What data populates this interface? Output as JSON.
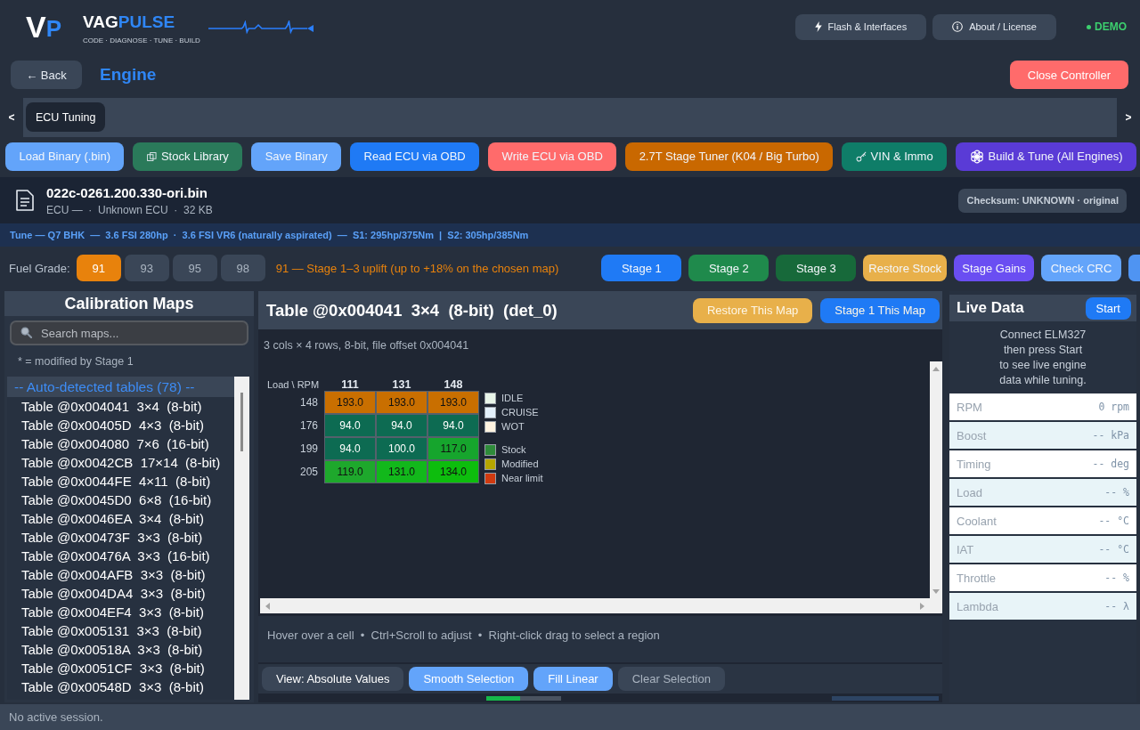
{
  "header": {
    "logo": [
      {
        "text": "V",
        "accent": false
      },
      {
        "text": "P",
        "accent": true
      }
    ],
    "brand": [
      {
        "text": "VAG",
        "accent": false
      },
      {
        "text": "PULSE",
        "accent": true
      }
    ],
    "tagline": "CODE · DIAGNOSE · TUNE · BUILD",
    "buttons": [
      {
        "label": "Flash & Interfaces"
      },
      {
        "label": "About / License"
      }
    ],
    "mode": {
      "label": "DEMO",
      "color": "#3ccf6e"
    }
  },
  "nav": {
    "back": "← Back",
    "title": "Engine",
    "close": "Close Controller"
  },
  "tabs": {
    "prev": "<",
    "next": ">",
    "items": [
      {
        "label": "ECU Tuning",
        "selected": true
      }
    ]
  },
  "toolbar": [
    {
      "label": "Load Binary (.bin)",
      "color": "#63a4fa"
    },
    {
      "label": "Stock Library",
      "color": "#2a7a5a"
    },
    {
      "label": "Save Binary",
      "color": "#63a4fa"
    },
    {
      "label": "Read ECU via OBD",
      "color": "#1f7af5"
    },
    {
      "label": "Write ECU via OBD",
      "color": "#ff6b6b"
    },
    {
      "label": "2.7T Stage Tuner (K04 / Big Turbo)",
      "color": "#c96800"
    },
    {
      "label": "VIN & Immo",
      "color": "#0f7d68"
    },
    {
      "label": "Build & Tune (All Engines)",
      "color": "#5a3bd6"
    }
  ],
  "file": {
    "name": "022c-0261.200.330-ori.bin",
    "meta": "ECU —  ·  Unknown ECU  ·  32 KB",
    "checksum": "Checksum: UNKNOWN · original"
  },
  "tune_line": "Tune — Q7 BHK  —  3.6 FSI 280hp  ·  3.6 FSI VR6 (naturally aspirated)  —  S1: 295hp/375Nm  |  S2: 305hp/385Nm",
  "fuel": {
    "label": "Fuel Grade:",
    "options": [
      {
        "label": "91",
        "selected": true
      },
      {
        "label": "93",
        "selected": false
      },
      {
        "label": "95",
        "selected": false
      },
      {
        "label": "98",
        "selected": false
      }
    ],
    "note": "91 — Stage 1–3 uplift (up to +18% on the chosen map)"
  },
  "stage_actions": [
    {
      "label": "Stage 1",
      "color": "#1f7af5"
    },
    {
      "label": "Stage 2",
      "color": "#1f8a4c"
    },
    {
      "label": "Stage 3",
      "color": "#17693a"
    },
    {
      "label": "Restore Stock",
      "color": "#e8b04a"
    },
    {
      "label": "Stage Gains",
      "color": "#6a4ef2"
    },
    {
      "label": "Check CRC",
      "color": "#63a4fa"
    }
  ],
  "stage_actions_cut": {
    "color": "#4f94f2"
  },
  "sidebar": {
    "title": "Calibration Maps",
    "search": {
      "placeholder": "Search maps..."
    },
    "note": "* = modified by Stage 1",
    "group": "-- Auto-detected tables (78) --",
    "items": [
      {
        "label": "Table @0x004041  3×4  (8-bit)",
        "selected": false
      },
      {
        "label": "Table @0x00405D  4×3  (8-bit)",
        "selected": false
      },
      {
        "label": "Table @0x004080  7×6  (16-bit)",
        "selected": false
      },
      {
        "label": "Table @0x0042CB  17×14  (8-bit)",
        "selected": false
      },
      {
        "label": "Table @0x0044FE  4×11  (8-bit)",
        "selected": false
      },
      {
        "label": "Table @0x0045D0  6×8  (16-bit)",
        "selected": false
      },
      {
        "label": "Table @0x0046EA  3×4  (8-bit)",
        "selected": false
      },
      {
        "label": "Table @0x00473F  3×3  (8-bit)",
        "selected": false
      },
      {
        "label": "Table @0x00476A  3×3  (16-bit)",
        "selected": false
      },
      {
        "label": "Table @0x004AFB  3×3  (8-bit)",
        "selected": false
      },
      {
        "label": "Table @0x004DA4  3×3  (8-bit)",
        "selected": false
      },
      {
        "label": "Table @0x004EF4  3×3  (8-bit)",
        "selected": false
      },
      {
        "label": "Table @0x005131  3×3  (8-bit)",
        "selected": false
      },
      {
        "label": "Table @0x00518A  3×3  (8-bit)",
        "selected": false
      },
      {
        "label": "Table @0x0051CF  3×3  (8-bit)",
        "selected": false
      },
      {
        "label": "Table @0x00548D  3×3  (8-bit)",
        "selected": false
      }
    ]
  },
  "editor": {
    "title": "Table @0x004041  3×4  (8-bit)  (det_0)",
    "actions": [
      {
        "label": "Restore This Map",
        "color": "#e8b04a"
      },
      {
        "label": "Stage 1 This Map",
        "color": "#1f7af5"
      }
    ],
    "subtitle": "3 cols × 4 rows, 8-bit, file offset 0x004041",
    "map_table": {
      "corner": "Load \\ RPM",
      "columns": [
        "111",
        "131",
        "148"
      ],
      "rows": [
        {
          "label": "148",
          "cells": [
            {
              "value": "193.0",
              "color": "#c96f00"
            },
            {
              "value": "193.0",
              "color": "#c96f00"
            },
            {
              "value": "193.0",
              "color": "#c96f00"
            }
          ]
        },
        {
          "label": "176",
          "cells": [
            {
              "value": "94.0",
              "color": "#0d6b52"
            },
            {
              "value": "94.0",
              "color": "#0d6b52"
            },
            {
              "value": "94.0",
              "color": "#0d6b52"
            }
          ]
        },
        {
          "label": "199",
          "cells": [
            {
              "value": "94.0",
              "color": "#0d6b52"
            },
            {
              "value": "100.0",
              "color": "#0d6b52"
            },
            {
              "value": "117.0",
              "color": "#16a52d"
            }
          ]
        },
        {
          "label": "205",
          "cells": [
            {
              "value": "119.0",
              "color": "#1ea82c"
            },
            {
              "value": "131.0",
              "color": "#12b81b"
            },
            {
              "value": "134.0",
              "color": "#0dbd0d"
            }
          ]
        }
      ]
    },
    "zone_legend": [
      {
        "label": "IDLE",
        "color": "#e8f5e9"
      },
      {
        "label": "CRUISE",
        "color": "#e3f0fb"
      },
      {
        "label": "WOT",
        "color": "#fff3e0"
      }
    ],
    "status_legend": [
      {
        "label": "Stock",
        "color": "#2e8b3a"
      },
      {
        "label": "Modified",
        "color": "#b5a600"
      },
      {
        "label": "Near limit",
        "color": "#d03a10"
      }
    ],
    "hint": "Hover over a cell  •  Ctrl+Scroll to adjust  •  Right-click drag to select a region",
    "tools": [
      {
        "label": "View: Absolute Values",
        "color": "#3a4657",
        "disabled": false
      },
      {
        "label": "Smooth Selection",
        "color": "#63a4fa",
        "disabled": false
      },
      {
        "label": "Fill Linear",
        "color": "#63a4fa",
        "disabled": false
      },
      {
        "label": "Clear Selection",
        "color": "#3a4657",
        "disabled": true
      }
    ],
    "ripple": {
      "level": 0.45
    }
  },
  "live": {
    "title": "Live Data",
    "start": "Start",
    "message": "Connect ELM327\nthen press Start\nto see live engine\ndata while tuning.",
    "rows": [
      {
        "label": "RPM",
        "value": "0 rpm"
      },
      {
        "label": "Boost",
        "value": "-- kPa"
      },
      {
        "label": "Timing",
        "value": "-- deg"
      },
      {
        "label": "Load",
        "value": "-- %"
      },
      {
        "label": "Coolant",
        "value": "-- °C"
      },
      {
        "label": "IAT",
        "value": "-- °C"
      },
      {
        "label": "Throttle",
        "value": "-- %"
      },
      {
        "label": "Lambda",
        "value": "-- λ"
      }
    ]
  },
  "status_bar": "No active session."
}
